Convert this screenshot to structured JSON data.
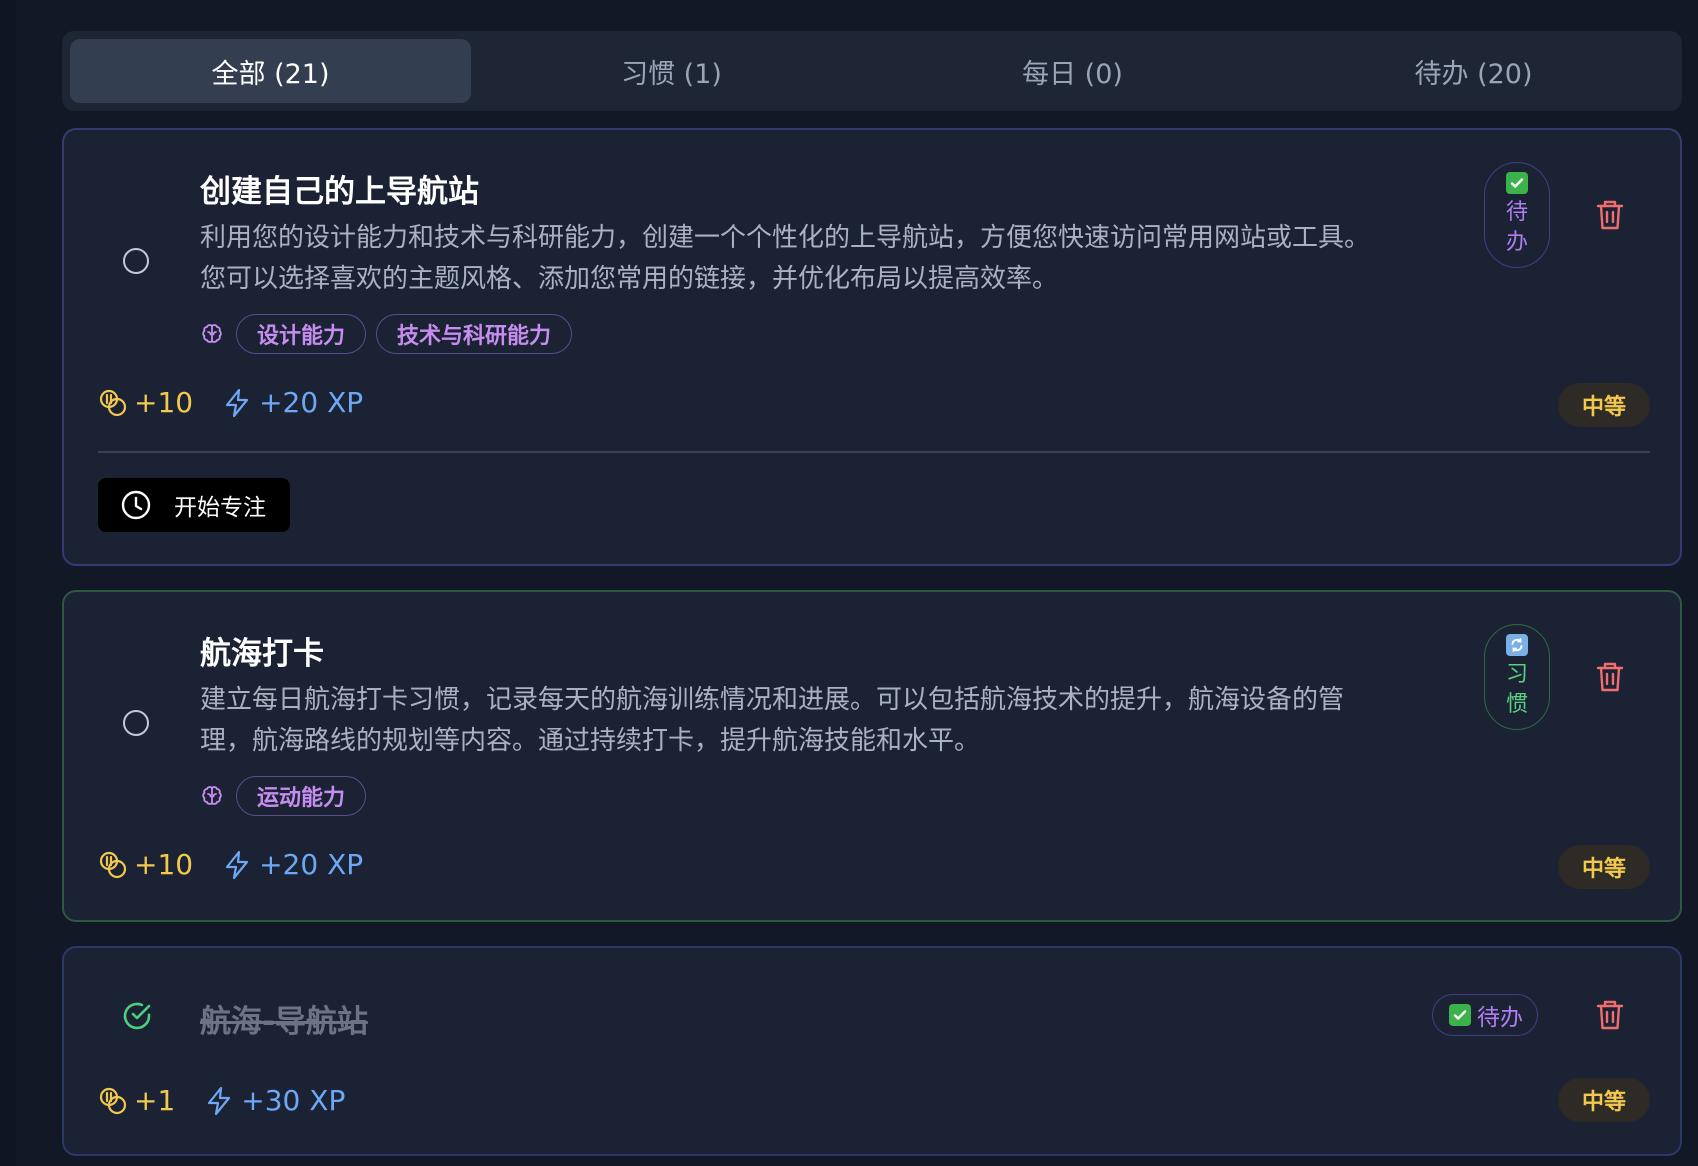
{
  "tabs": [
    {
      "label": "全部 (21)",
      "active": true
    },
    {
      "label": "习惯 (1)",
      "active": false
    },
    {
      "label": "每日 (0)",
      "active": false
    },
    {
      "label": "待办 (20)",
      "active": false
    }
  ],
  "colors": {
    "background": "#121826",
    "card": "#1b2234",
    "coin": "#f2c94c",
    "xp": "#6ea8f5",
    "skill": "#c68df0",
    "habit_green": "#5ad17f",
    "trash": "#f26d6d",
    "difficulty": "#f2c94c"
  },
  "tasks": [
    {
      "title": "创建自己的上导航站",
      "description_lines": [
        "利用您的设计能力和技术与科研能力，创建一个个性化的上导航站，方便您快速访问常用网站或工具。",
        "您可以选择喜欢的主题风格、添加您常用的链接，并优化布局以提高效率。"
      ],
      "skills": [
        "设计能力",
        "技术与科研能力"
      ],
      "coins": "+10",
      "xp": "+20 XP",
      "type_emoji": "check-emoji",
      "type_chars": [
        "待",
        "办"
      ],
      "difficulty": "中等",
      "focus_button": "开始专注",
      "completed": false
    },
    {
      "title": "航海打卡",
      "description_lines": [
        "建立每日航海打卡习惯，记录每天的航海训练情况和进展。可以包括航海技术的提升，航海设备的管",
        "理，航海路线的规划等内容。通过持续打卡，提升航海技能和水平。"
      ],
      "skills": [
        "运动能力"
      ],
      "coins": "+10",
      "xp": "+20 XP",
      "type_emoji": "repeat-emoji",
      "type_chars": [
        "习",
        "惯"
      ],
      "difficulty": "中等",
      "completed": false
    },
    {
      "title": "航海-导航站",
      "coins": "+1",
      "xp": "+30 XP",
      "type_emoji": "check-emoji",
      "type_label": "待办",
      "difficulty": "中等",
      "completed": true
    }
  ]
}
